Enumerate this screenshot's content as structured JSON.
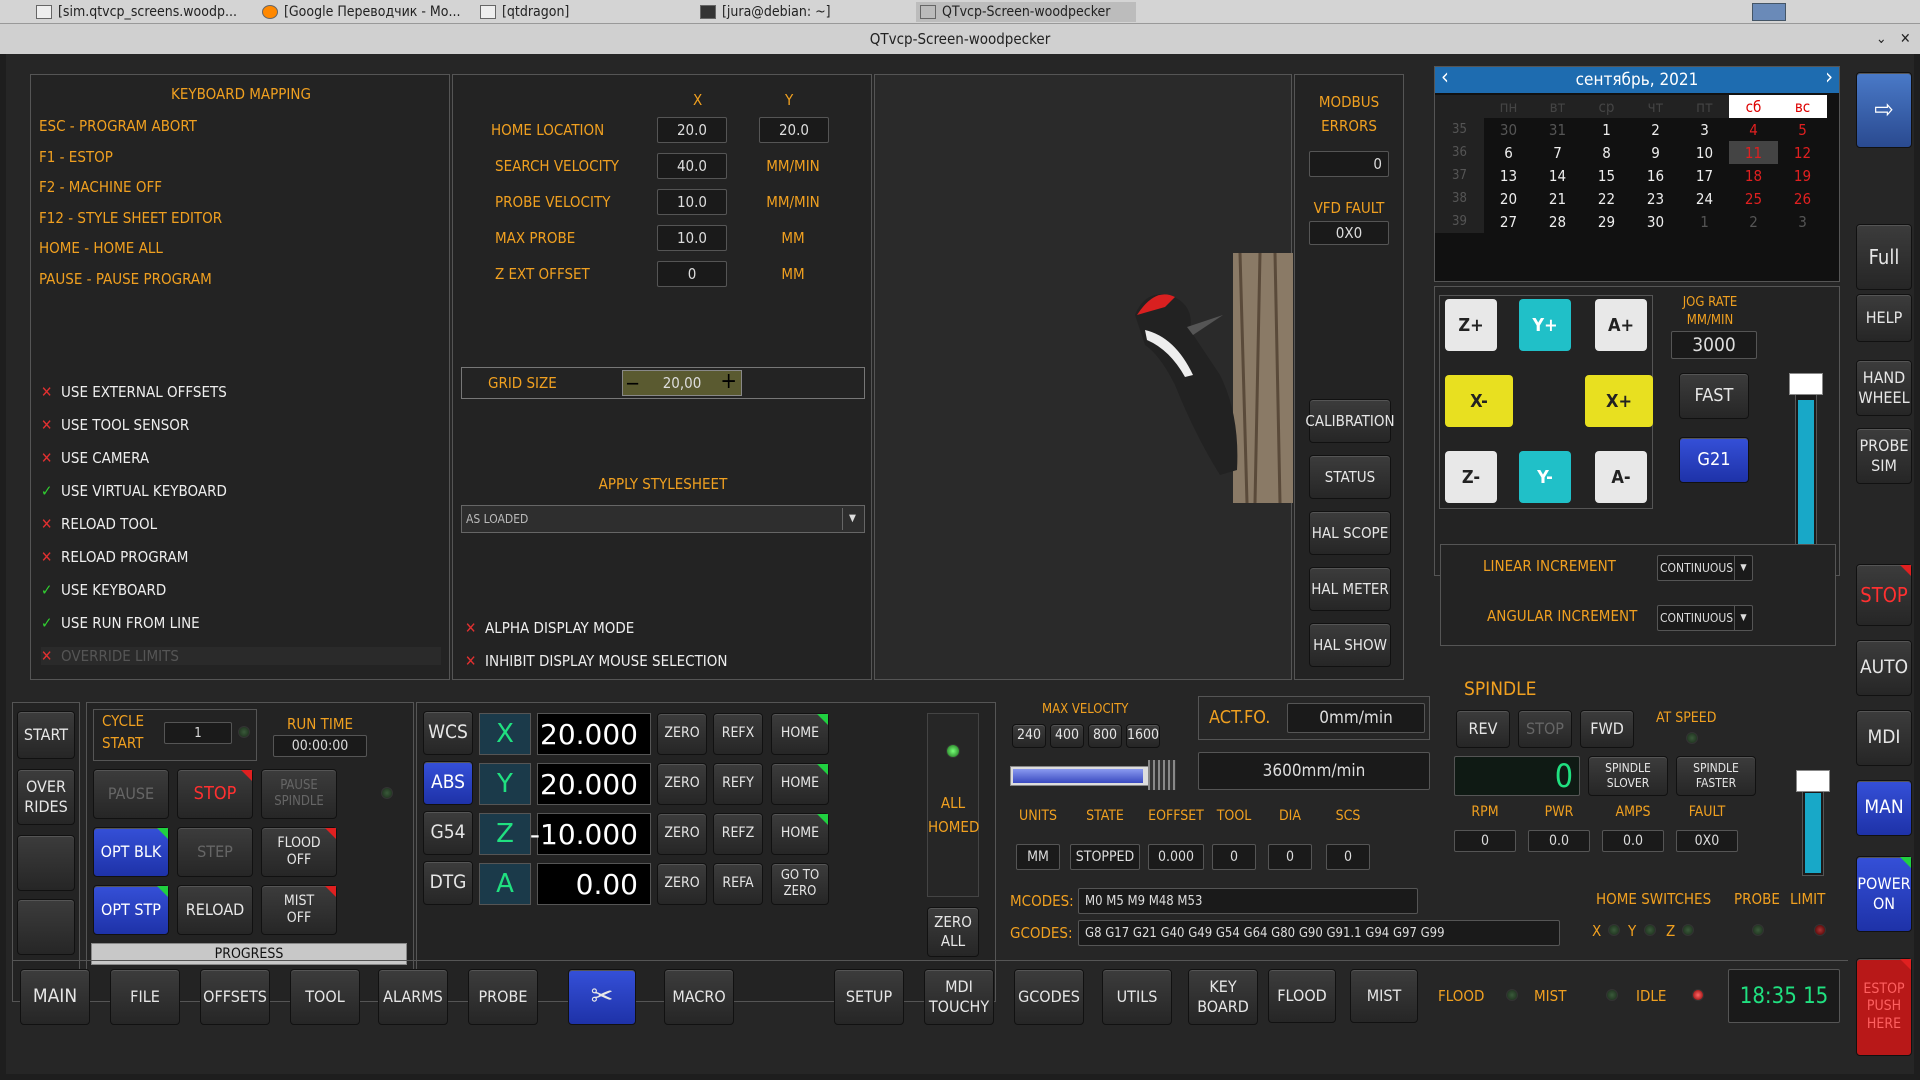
{
  "taskbar": {
    "tasks": [
      "[sim.qtvcp_screens.woodp...",
      "[Google Переводчик - Мо...",
      "[qtdragon]",
      "[jura@debian: ~]",
      "QTvcp-Screen-woodpecker"
    ]
  },
  "window": {
    "title": "QTvcp-Screen-woodpecker"
  },
  "keyboard": {
    "title": "KEYBOARD MAPPING",
    "items": [
      "ESC - PROGRAM ABORT",
      "F1 - ESTOP",
      "F2 - MACHINE OFF",
      "F12 - STYLE SHEET EDITOR",
      "HOME - HOME ALL",
      "PAUSE - PAUSE PROGRAM"
    ]
  },
  "options": [
    {
      "label": "USE EXTERNAL OFFSETS",
      "m": "✕"
    },
    {
      "label": "USE TOOL SENSOR",
      "m": "✕"
    },
    {
      "label": "USE CAMERA",
      "m": "✕"
    },
    {
      "label": "USE VIRTUAL KEYBOARD",
      "m": "✓"
    },
    {
      "label": "RELOAD TOOL",
      "m": "✕"
    },
    {
      "label": "RELOAD PROGRAM",
      "m": "✕"
    },
    {
      "label": "USE KEYBOARD",
      "m": "✓"
    },
    {
      "label": "USE RUN FROM LINE",
      "m": "✓"
    },
    {
      "label": "OVERRIDE LIMITS",
      "m": "✕"
    }
  ],
  "settings": {
    "col_x": "X",
    "col_y": "Y",
    "rows": [
      {
        "label": "HOME LOCATION",
        "x": "20.0",
        "y": "20.0"
      },
      {
        "label": "SEARCH VELOCITY",
        "x": "40.0",
        "y": "MM/MIN"
      },
      {
        "label": "PROBE VELOCITY",
        "x": "10.0",
        "y": "MM/MIN"
      },
      {
        "label": "MAX PROBE",
        "x": "10.0",
        "y": "MM"
      },
      {
        "label": "Z EXT OFFSET",
        "x": "0",
        "y": "MM"
      }
    ],
    "grid_label": "GRID SIZE",
    "grid_value": "20,00",
    "minus": "−",
    "plus": "+",
    "stylesheet_title": "APPLY STYLESHEET",
    "stylesheet_value": "AS LOADED",
    "alpha": "ALPHA DISPLAY MODE",
    "inhibit": "INHIBIT DISPLAY MOUSE SELECTION",
    "mark_x": "✕"
  },
  "modbus": {
    "title1": "MODBUS",
    "title2": "ERRORS",
    "value": "0",
    "vfd_label": "VFD FAULT",
    "vfd_value": "0X0",
    "buttons": [
      "CALIBRATION",
      "STATUS",
      "HAL SCOPE",
      "HAL METER",
      "HAL SHOW"
    ]
  },
  "calendar": {
    "month": "сентябрь,",
    "year": "2021",
    "prev": "‹",
    "next": "›",
    "days": [
      "пн",
      "вт",
      "ср",
      "чт",
      "пт",
      "сб",
      "вс"
    ],
    "weeks": [
      {
        "n": "35",
        "d": [
          "30",
          "31",
          "1",
          "2",
          "3",
          "4",
          "5"
        ]
      },
      {
        "n": "36",
        "d": [
          "6",
          "7",
          "8",
          "9",
          "10",
          "11",
          "12"
        ]
      },
      {
        "n": "37",
        "d": [
          "13",
          "14",
          "15",
          "16",
          "17",
          "18",
          "19"
        ]
      },
      {
        "n": "38",
        "d": [
          "20",
          "21",
          "22",
          "23",
          "24",
          "25",
          "26"
        ]
      },
      {
        "n": "39",
        "d": [
          "27",
          "28",
          "29",
          "30",
          "1",
          "2",
          "3"
        ]
      }
    ]
  },
  "jog": {
    "rate_label1": "JOG RATE",
    "rate_label2": "MM/MIN",
    "rate_value": "3000",
    "fast": "FAST",
    "units": "G21",
    "keys": {
      "zp": "Z+",
      "yp": "Y+",
      "ap": "A+",
      "xm": "X-",
      "xp": "X+",
      "zm": "Z-",
      "ym": "Y-",
      "am": "A-"
    },
    "linear_label": "LINEAR INCREMENT",
    "linear_value": "CONTINUOUS",
    "angular_label": "ANGULAR INCREMENT",
    "angular_value": "CONTINUOUS",
    "slider_level": 0.95
  },
  "right_buttons": {
    "full": "Full",
    "help": "HELP",
    "hand1": "HAND",
    "hand2": "WHEEL",
    "probe1": "PROBE",
    "probe2": "SIM",
    "stop": "STOP",
    "auto": "AUTO",
    "mdi": "MDI",
    "man": "MAN",
    "power1": "POWER",
    "power2": "ON",
    "estop1": "ESTOP",
    "estop2": "PUSH",
    "estop3": "HERE"
  },
  "left_controls": {
    "start": "START",
    "over1": "OVER",
    "over2": "RIDES"
  },
  "cycle": {
    "c1": "CYCLE",
    "c2": "START",
    "count": "1",
    "runtime_label": "RUN TIME",
    "runtime": "00:00:00",
    "pause": "PAUSE",
    "stop": "STOP",
    "ps1": "PAUSE",
    "ps2": "SPINDLE",
    "optblk": "OPT BLK",
    "step": "STEP",
    "fl1": "FLOOD",
    "fl2": "OFF",
    "optstp": "OPT STP",
    "reload": "RELOAD",
    "mi1": "MIST",
    "mi2": "OFF",
    "progress": "PROGRESS",
    "progress_value": 0
  },
  "dro": {
    "coord": [
      "WCS",
      "ABS",
      "G54",
      "DTG"
    ],
    "axes": [
      {
        "n": "X",
        "v": "20.000",
        "ref": "REFX"
      },
      {
        "n": "Y",
        "v": "20.000",
        "ref": "REFY"
      },
      {
        "n": "Z",
        "v": "-10.000",
        "ref": "REFZ"
      },
      {
        "n": "A",
        "v": "0.00",
        "ref": "REFA"
      }
    ],
    "zero": "ZERO",
    "home": "HOME",
    "goto1": "GO TO",
    "goto2": "ZERO",
    "allhomed1": "ALL",
    "allhomed2": "HOMED",
    "zeroall1": "ZERO",
    "zeroall2": "ALL"
  },
  "velocity": {
    "label": "MAX VELOCITY",
    "presets": [
      "240",
      "400",
      "800",
      "1600"
    ],
    "actfo_label": "ACT.FO.",
    "actfo": "0mm/min",
    "max": "3600mm/min",
    "level": 0.9
  },
  "status": {
    "headers": [
      "UNITS",
      "STATE",
      "EOFFSET",
      "TOOL",
      "DIA",
      "SCS"
    ],
    "values": [
      "MM",
      "STOPPED",
      "0.000",
      "0",
      "0",
      "0"
    ]
  },
  "codes": {
    "mlabel": "MCODES:",
    "m": "M0 M5 M9 M48 M53",
    "glabel": "GCODES:",
    "g": "G8 G17 G21 G40 G49 G54 G64 G80 G90 G91.1 G94 G97 G99"
  },
  "spindle": {
    "title": "SPINDLE",
    "rev": "REV",
    "stop": "STOP",
    "fwd": "FWD",
    "atspeed1": "AT SPEED",
    "rpm_display": "0",
    "sl1": "SPINDLE",
    "sl2": "SLOVER",
    "fa1": "SPINDLE",
    "fa2": "FASTER",
    "labels": [
      "RPM",
      "PWR",
      "AMPS",
      "FAULT"
    ],
    "values": [
      "0",
      "0.0",
      "0.0",
      "0X0"
    ]
  },
  "homesw": {
    "title": "HOME SWITCHES",
    "probe": "PROBE",
    "limit": "LIMIT",
    "x": "X",
    "y": "Y",
    "z": "Z"
  },
  "bottom": {
    "tabs": [
      "MAIN",
      "FILE",
      "OFFSETS",
      "TOOL",
      "ALARMS",
      "PROBE",
      "",
      "MACRO",
      "SETUP",
      "MDI\nTOUCHY",
      "GCODES",
      "UTILS",
      "KEY\nBOARD"
    ],
    "flood": "FLOOD",
    "mist": "MIST",
    "flood_ind": "FLOOD",
    "mist_ind": "MIST",
    "idle": "IDLE",
    "clock": "18:35 15"
  }
}
